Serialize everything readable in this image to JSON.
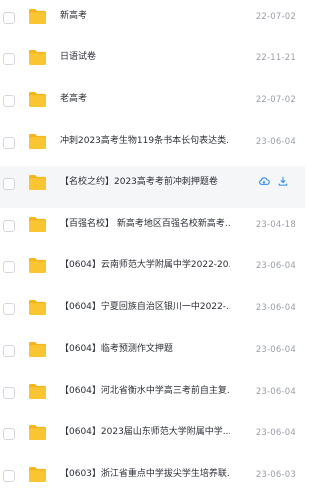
{
  "files": [
    {
      "name": "新高考",
      "date": "22-07-02"
    },
    {
      "name": "日语试卷",
      "date": "22-11-21"
    },
    {
      "name": "老高考",
      "date": "22-07-02"
    },
    {
      "name": "冲刺2023高考生物119条书本长句表达类...",
      "date": "23-06-04"
    },
    {
      "name": "【名校之约】2023高考考前冲刺押题卷（...",
      "date": "23-04-18",
      "hover": true
    },
    {
      "name": "【百强名校】 新高考地区百强名校新高考...",
      "date": "23-04-18"
    },
    {
      "name": "【0604】云南师范大学附属中学2022-20...",
      "date": "23-06-04"
    },
    {
      "name": "【0604】宁夏回族自治区银川一中2022-...",
      "date": "23-06-04"
    },
    {
      "name": "【0604】临考预测作文押题",
      "date": "23-06-04"
    },
    {
      "name": "【0604】河北省衡水中学高三考前自主复...",
      "date": "23-06-04"
    },
    {
      "name": "【0604】2023届山东师范大学附属中学...",
      "date": "23-06-04"
    },
    {
      "name": "【0603】浙江省重点中学拔尖学生培养联...",
      "date": "23-06-03"
    }
  ],
  "icons": {
    "folder": "folder-icon",
    "cloud": "cloud-download-icon",
    "download": "download-icon"
  },
  "colors": {
    "folder": "#f9c533",
    "folder_tab": "#f4b51f",
    "action": "#2b8bf2"
  }
}
